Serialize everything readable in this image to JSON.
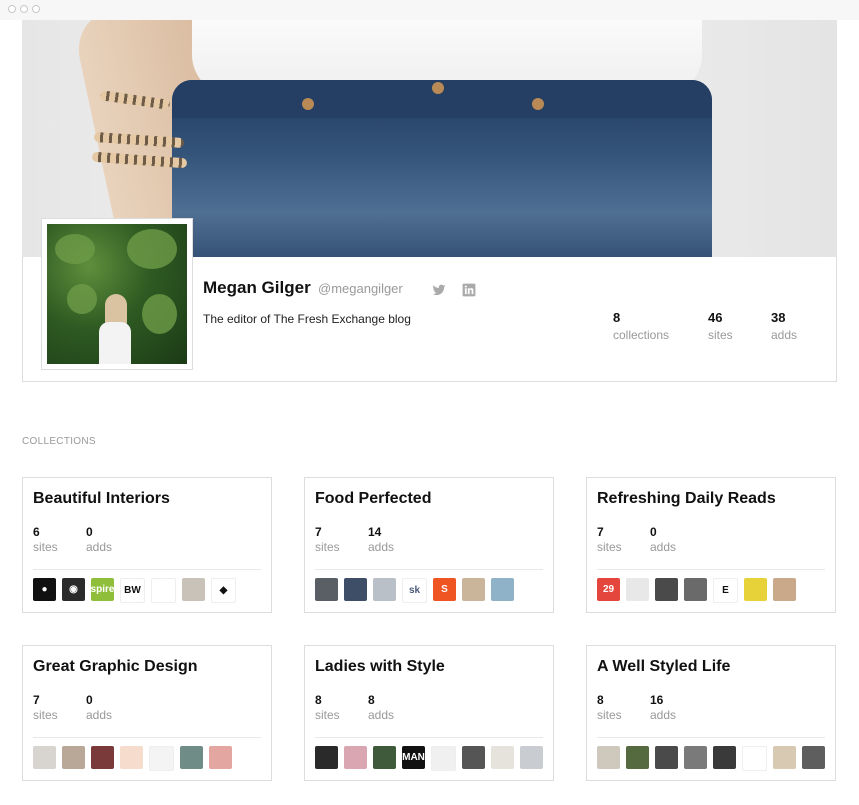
{
  "profile": {
    "name": "Megan Gilger",
    "handle": "@megangilger",
    "bio": "The editor of The Fresh Exchange blog",
    "social": [
      "twitter-icon",
      "linkedin-icon"
    ],
    "stats": [
      {
        "value": "8",
        "label": "collections"
      },
      {
        "value": "46",
        "label": "sites"
      },
      {
        "value": "38",
        "label": "adds"
      }
    ]
  },
  "collections_heading": "COLLECTIONS",
  "collections": [
    {
      "title": "Beautiful Interiors",
      "sites": "6",
      "sites_label": "sites",
      "adds": "0",
      "adds_label": "adds",
      "thumbs": [
        {
          "bg": "#111111",
          "text": "●"
        },
        {
          "bg": "#2b2b2b",
          "text": "◉"
        },
        {
          "bg": "#8fbf3a",
          "text": "spire"
        },
        {
          "bg": "#ffffff",
          "text": "BW",
          "fg": "#111111"
        },
        {
          "bg": "#ffffff",
          "text": ""
        },
        {
          "bg": "#c9c2b8",
          "text": ""
        },
        {
          "bg": "#ffffff",
          "text": "◆",
          "fg": "#111111"
        }
      ]
    },
    {
      "title": "Food Perfected",
      "sites": "7",
      "sites_label": "sites",
      "adds": "14",
      "adds_label": "adds",
      "thumbs": [
        {
          "bg": "#5a5f66",
          "text": ""
        },
        {
          "bg": "#3d4e66",
          "text": ""
        },
        {
          "bg": "#b9c0c7",
          "text": ""
        },
        {
          "bg": "#ffffff",
          "text": "sk",
          "fg": "#4a5a7a"
        },
        {
          "bg": "#ee5522",
          "text": "S"
        },
        {
          "bg": "#cbb59a",
          "text": ""
        },
        {
          "bg": "#8fb2c9",
          "text": ""
        }
      ]
    },
    {
      "title": "Refreshing Daily Reads",
      "sites": "7",
      "sites_label": "sites",
      "adds": "0",
      "adds_label": "adds",
      "thumbs": [
        {
          "bg": "#e4453c",
          "text": "29"
        },
        {
          "bg": "#e8e8e8",
          "text": ""
        },
        {
          "bg": "#4a4a4a",
          "text": ""
        },
        {
          "bg": "#6a6a6a",
          "text": ""
        },
        {
          "bg": "#ffffff",
          "text": "E",
          "fg": "#111111"
        },
        {
          "bg": "#e8d23a",
          "text": ""
        },
        {
          "bg": "#c9a98a",
          "text": ""
        }
      ]
    },
    {
      "title": "Great Graphic Design",
      "sites": "7",
      "sites_label": "sites",
      "adds": "0",
      "adds_label": "adds",
      "thumbs": [
        {
          "bg": "#d8d4cf",
          "text": ""
        },
        {
          "bg": "#b9a898",
          "text": ""
        },
        {
          "bg": "#7a3a3a",
          "text": ""
        },
        {
          "bg": "#f6dccd",
          "text": ""
        },
        {
          "bg": "#f4f4f4",
          "text": ""
        },
        {
          "bg": "#6f8c86",
          "text": ""
        },
        {
          "bg": "#e4a6a0",
          "text": ""
        }
      ]
    },
    {
      "title": "Ladies with Style",
      "sites": "8",
      "sites_label": "sites",
      "adds": "8",
      "adds_label": "adds",
      "thumbs": [
        {
          "bg": "#2a2a2a",
          "text": ""
        },
        {
          "bg": "#d9a6b2",
          "text": ""
        },
        {
          "bg": "#3f5a3a",
          "text": ""
        },
        {
          "bg": "#111111",
          "text": "MAN"
        },
        {
          "bg": "#f0f0f0",
          "text": ""
        },
        {
          "bg": "#555555",
          "text": ""
        },
        {
          "bg": "#e6e3dd",
          "text": ""
        },
        {
          "bg": "#c9ccd0",
          "text": ""
        }
      ]
    },
    {
      "title": "A Well Styled Life",
      "sites": "8",
      "sites_label": "sites",
      "adds": "16",
      "adds_label": "adds",
      "thumbs": [
        {
          "bg": "#cfc8bd",
          "text": ""
        },
        {
          "bg": "#556b3f",
          "text": ""
        },
        {
          "bg": "#4a4a4a",
          "text": ""
        },
        {
          "bg": "#7a7a7a",
          "text": ""
        },
        {
          "bg": "#3a3a3a",
          "text": ""
        },
        {
          "bg": "#ffffff",
          "text": ""
        },
        {
          "bg": "#d7c9b2",
          "text": ""
        },
        {
          "bg": "#5e5e5e",
          "text": ""
        }
      ]
    }
  ]
}
